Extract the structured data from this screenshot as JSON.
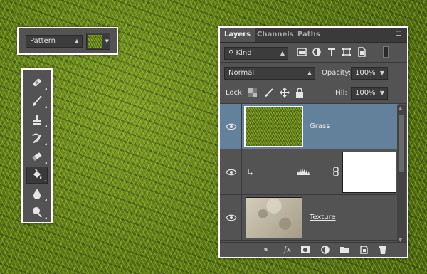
{
  "options_bar": {
    "mode_value": "Pattern",
    "pattern_swatch": "grass-pattern"
  },
  "tools": [
    {
      "name": "spot-healing-brush-tool",
      "active": false
    },
    {
      "name": "brush-tool",
      "active": false
    },
    {
      "name": "clone-stamp-tool",
      "active": false
    },
    {
      "name": "history-brush-tool",
      "active": false
    },
    {
      "name": "eraser-tool",
      "active": false
    },
    {
      "name": "paint-bucket-tool",
      "active": true
    },
    {
      "name": "blur-tool",
      "active": false
    },
    {
      "name": "dodge-tool",
      "active": false
    }
  ],
  "layers_panel": {
    "tabs": [
      "Layers",
      "Channels",
      "Paths"
    ],
    "active_tab": "Layers",
    "filter": {
      "value": "Kind"
    },
    "blend_mode": "Normal",
    "opacity_label": "Opacity:",
    "opacity_value": "100%",
    "lock_label": "Lock:",
    "fill_label": "Fill:",
    "fill_value": "100%",
    "layers": [
      {
        "name": "Grass",
        "selected": true,
        "visible": true
      },
      {
        "name": "",
        "type": "adjustment-levels",
        "selected": false,
        "visible": true
      },
      {
        "name": "Texture",
        "selected": false,
        "visible": true
      }
    ]
  },
  "colors": {
    "panel_bg": "#535353",
    "selected_row": "#64819c",
    "border": "#ffffff"
  }
}
